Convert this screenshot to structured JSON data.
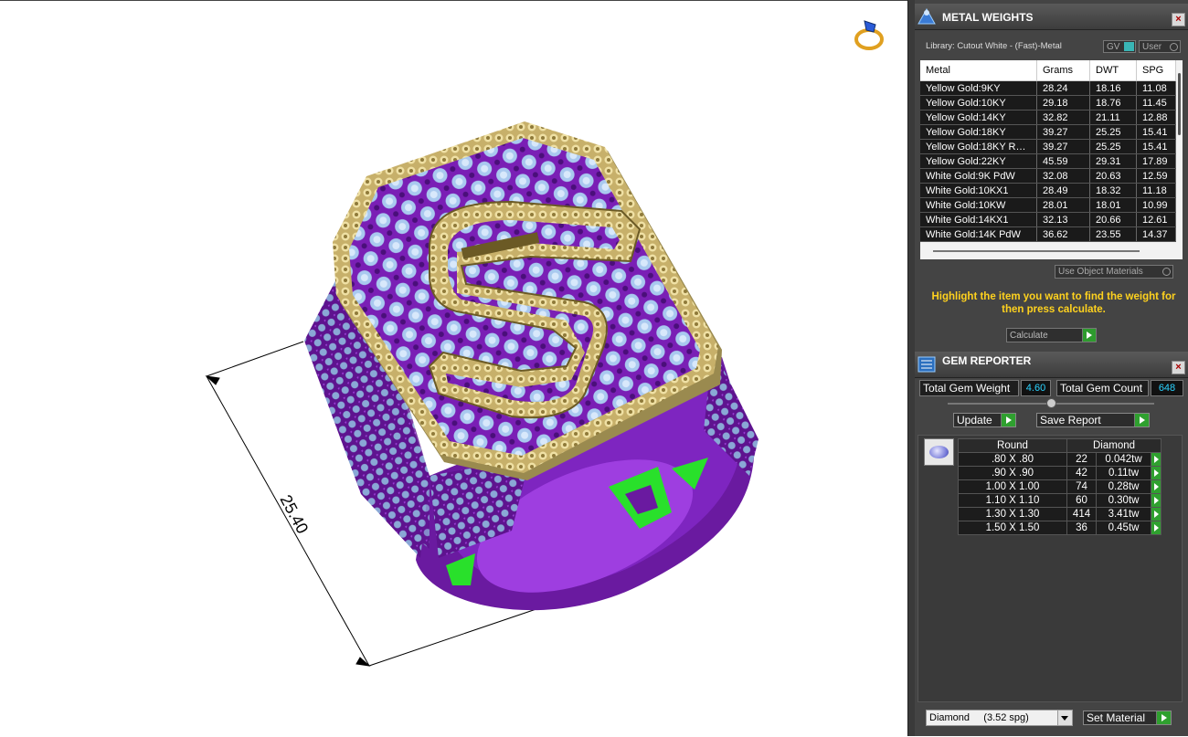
{
  "viewport": {
    "dimension_value": "25.40",
    "colors": {
      "gold": "#c7b06a",
      "purple": "#7a1fb5",
      "gem": "#8fb6e3",
      "green": "#29e02b"
    }
  },
  "metal_weights": {
    "title": "METAL WEIGHTS",
    "library_label": "Library: Cutout White - (Fast)-Metal",
    "gv_label": "GV",
    "user_label": "User",
    "columns": [
      "Metal",
      "Grams",
      "DWT",
      "SPG"
    ],
    "rows": [
      [
        "Yellow Gold:9KY",
        "28.24",
        "18.16",
        "11.08"
      ],
      [
        "Yellow Gold:10KY",
        "29.18",
        "18.76",
        "11.45"
      ],
      [
        "Yellow Gold:14KY",
        "32.82",
        "21.11",
        "12.88"
      ],
      [
        "Yellow Gold:18KY",
        "39.27",
        "25.25",
        "15.41"
      ],
      [
        "Yellow Gold:18KY R…",
        "39.27",
        "25.25",
        "15.41"
      ],
      [
        "Yellow Gold:22KY",
        "45.59",
        "29.31",
        "17.89"
      ],
      [
        "White Gold:9K PdW",
        "32.08",
        "20.63",
        "12.59"
      ],
      [
        "White Gold:10KX1",
        "28.49",
        "18.32",
        "11.18"
      ],
      [
        "White Gold:10KW",
        "28.01",
        "18.01",
        "10.99"
      ],
      [
        "White Gold:14KX1",
        "32.13",
        "20.66",
        "12.61"
      ],
      [
        "White Gold:14K PdW",
        "36.62",
        "23.55",
        "14.37"
      ]
    ],
    "use_object_materials": "Use Object Materials",
    "message": "Highlight the item you want to find the weight for then press calculate.",
    "calculate_label": "Calculate"
  },
  "gem_reporter": {
    "title": "GEM REPORTER",
    "total_weight_label": "Total Gem Weight",
    "total_weight_value": "4.60",
    "total_count_label": "Total Gem Count",
    "total_count_value": "648",
    "update_label": "Update",
    "save_report_label": "Save Report",
    "columns": [
      "Round",
      "Diamond"
    ],
    "rows": [
      [
        ".80 X .80",
        "22",
        "0.042tw"
      ],
      [
        ".90 X .90",
        "42",
        "0.11tw"
      ],
      [
        "1.00 X 1.00",
        "74",
        "0.28tw"
      ],
      [
        "1.10 X 1.10",
        "60",
        "0.30tw"
      ],
      [
        "1.30 X 1.30",
        "414",
        "3.41tw"
      ],
      [
        "1.50 X 1.50",
        "36",
        "0.45tw"
      ]
    ],
    "material_select": "Diamond     (3.52 spg)",
    "set_material_label": "Set Material"
  }
}
